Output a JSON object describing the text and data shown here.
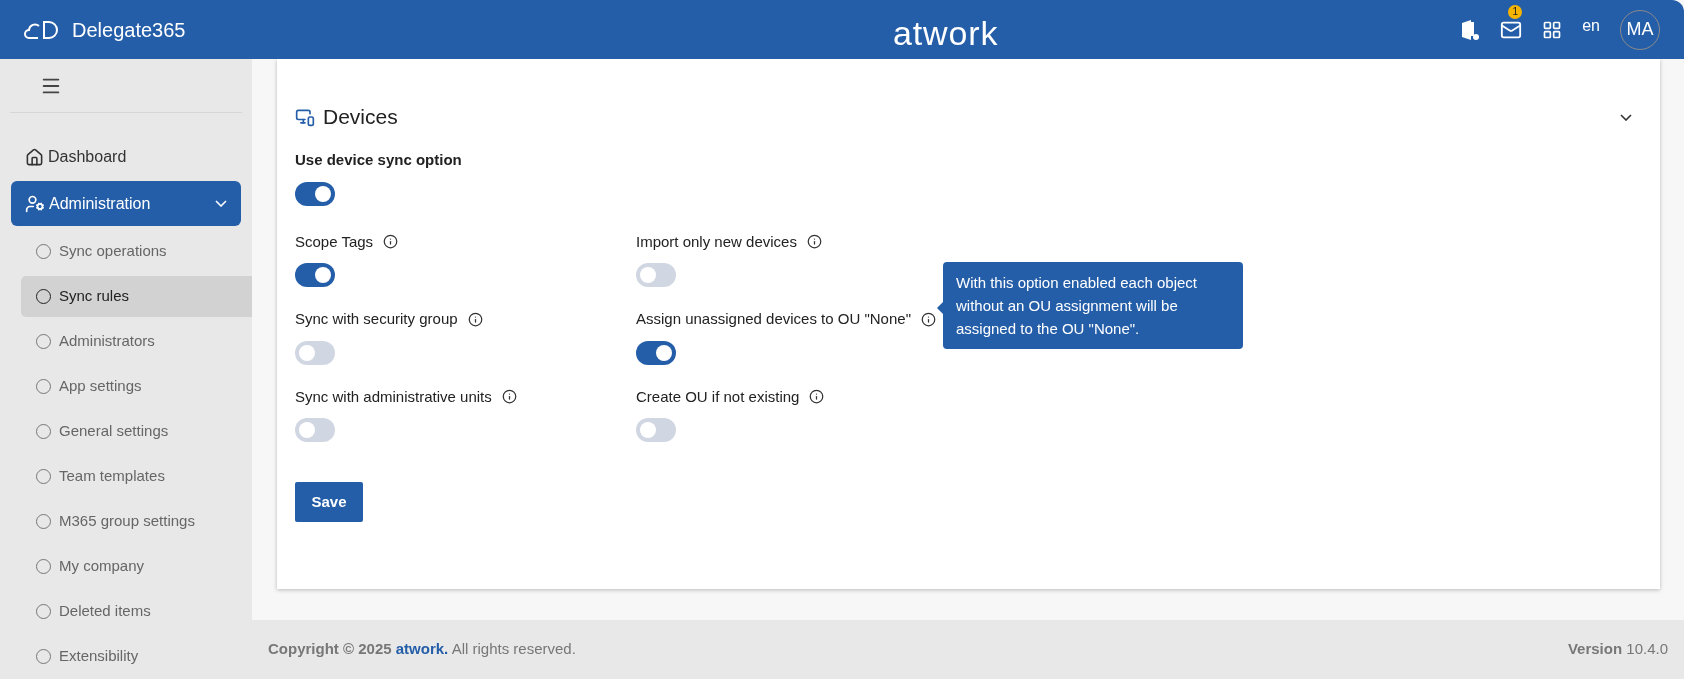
{
  "header": {
    "app_name": "Delegate365",
    "brand": "atwork",
    "notification_count": "1",
    "language": "en",
    "avatar_initials": "MA"
  },
  "sidebar": {
    "items": [
      {
        "label": "Dashboard",
        "kind": "link",
        "selected": false
      },
      {
        "label": "Administration",
        "kind": "group",
        "selected": true,
        "expanded": true,
        "children": [
          {
            "label": "Sync operations",
            "selected": false
          },
          {
            "label": "Sync rules",
            "selected": true
          },
          {
            "label": "Administrators",
            "selected": false
          },
          {
            "label": "App settings",
            "selected": false
          },
          {
            "label": "General settings",
            "selected": false
          },
          {
            "label": "Team templates",
            "selected": false
          },
          {
            "label": "M365 group settings",
            "selected": false
          },
          {
            "label": "My company",
            "selected": false
          },
          {
            "label": "Deleted items",
            "selected": false
          },
          {
            "label": "Extensibility",
            "selected": false
          }
        ]
      }
    ]
  },
  "section": {
    "title": "Devices",
    "expanded": true,
    "master_option": {
      "label": "Use device sync option",
      "on": true
    },
    "options": [
      {
        "label": "Scope Tags",
        "on": true
      },
      {
        "label": "Sync with security group",
        "on": false
      },
      {
        "label": "Sync with administrative units",
        "on": false
      },
      {
        "label": "Import only new devices",
        "on": false
      },
      {
        "label": "Assign unassigned devices to OU \"None\"",
        "on": true,
        "tooltip": "With this option enabled each object without an OU assignment will be assigned to the OU \"None\"."
      },
      {
        "label": "Create OU if not existing",
        "on": false
      }
    ],
    "save_button": "Save"
  },
  "footer": {
    "copyright": "**Copyright © 2025**",
    "company": "atwork.",
    "rights": "All rights reserved.",
    "version": "**Version** 10.4.0"
  }
}
